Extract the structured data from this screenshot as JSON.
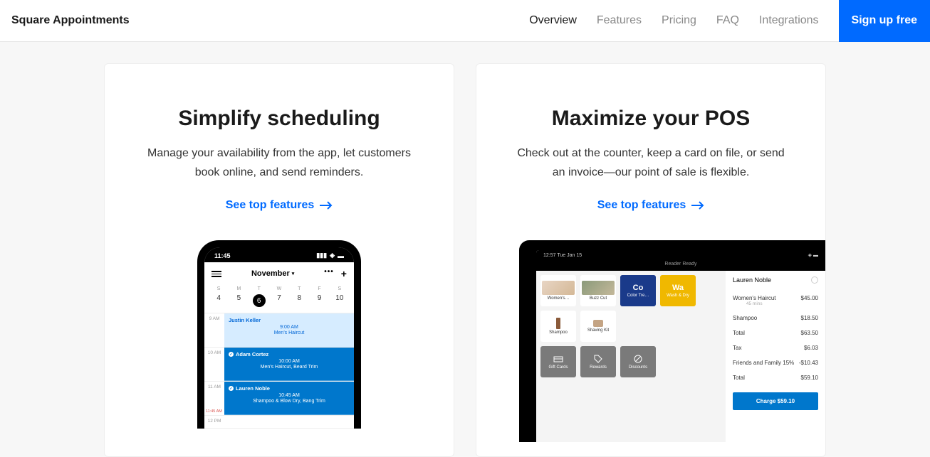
{
  "header": {
    "brand": "Square Appointments",
    "nav": {
      "overview": "Overview",
      "features": "Features",
      "pricing": "Pricing",
      "faq": "FAQ",
      "integrations": "Integrations"
    },
    "signup": "Sign up free"
  },
  "cards": {
    "scheduling": {
      "title": "Simplify scheduling",
      "desc": "Manage your availability from the app, let customers book online, and send reminders.",
      "link": "See top features"
    },
    "pos": {
      "title": "Maximize your POS",
      "desc": "Check out at the counter, keep a card on file, or send an invoice—our point of sale is flexible.",
      "link": "See top features"
    }
  },
  "phone": {
    "status_time": "11:45",
    "month": "November",
    "week_days": [
      "S",
      "M",
      "T",
      "W",
      "T",
      "F",
      "S"
    ],
    "dates": [
      "4",
      "5",
      "6",
      "7",
      "8",
      "9",
      "10"
    ],
    "selected_date": "6",
    "events": [
      {
        "hour": "9 AM",
        "name": "Justin Keller",
        "time": "9:00 AM",
        "desc": "Men's Haircut",
        "style": "light"
      },
      {
        "hour": "10 AM",
        "name": "Adam Cortez",
        "time": "10:00 AM",
        "desc": "Men's Haircut, Beard Trim",
        "style": "dark"
      },
      {
        "hour": "11 AM",
        "name": "Lauren Noble",
        "time": "10:45 AM",
        "desc": "Shampoo & Blow Dry, Bang Trim",
        "style": "dark"
      }
    ],
    "red_time": "11:45 AM",
    "last_hour": "12 PM"
  },
  "tablet": {
    "status_time": "12:57 Tue Jan 15",
    "header": "Reader Ready",
    "grid": {
      "womens": "Women's…",
      "buzz": "Buzz Cut",
      "color_code": "Co",
      "color": "Color Tre…",
      "wash_code": "Wa",
      "wash": "Wash & Dry",
      "shampoo": "Shampoo",
      "shaving": "Shaving Kit",
      "gift": "Gift Cards",
      "rewards": "Rewards",
      "discounts": "Discounts"
    },
    "receipt": {
      "customer": "Lauren Noble",
      "lines": [
        {
          "label": "Women's Haircut",
          "sub": "45 mins",
          "amount": "$45.00"
        },
        {
          "label": "Shampoo",
          "sub": "",
          "amount": "$18.50"
        },
        {
          "label": "Total",
          "sub": "",
          "amount": "$63.50"
        },
        {
          "label": "Tax",
          "sub": "",
          "amount": "$6.03"
        },
        {
          "label": "Friends and Family 15%",
          "sub": "",
          "amount": "-$10.43"
        },
        {
          "label": "Total",
          "sub": "",
          "amount": "$59.10"
        }
      ],
      "charge": "Charge $59.10"
    }
  }
}
